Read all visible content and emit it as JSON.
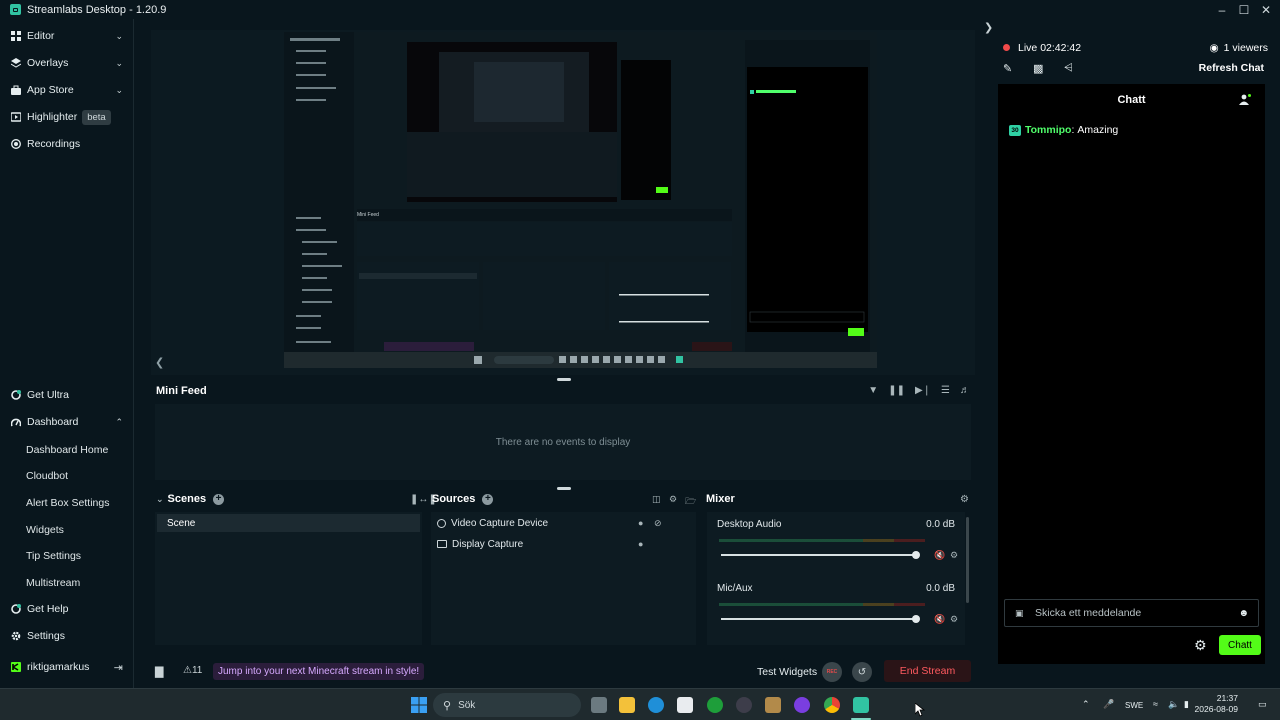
{
  "app": {
    "title": "Streamlabs Desktop - 1.20.9"
  },
  "nav": {
    "items": [
      {
        "label": "Editor"
      },
      {
        "label": "Overlays"
      },
      {
        "label": "App Store"
      },
      {
        "label": "Highlighter",
        "badge": "beta"
      },
      {
        "label": "Recordings"
      }
    ],
    "bottom": {
      "get_ultra": "Get Ultra",
      "dashboard": "Dashboard",
      "dashboard_items": [
        "Dashboard Home",
        "Cloudbot",
        "Alert Box Settings",
        "Widgets",
        "Tip Settings",
        "Multistream"
      ],
      "get_help": "Get Help",
      "settings": "Settings",
      "username": "riktigamarkus"
    }
  },
  "mini_feed": {
    "title": "Mini Feed",
    "empty_text": "There are no events to display"
  },
  "scenes": {
    "title": "Scenes",
    "items": [
      "Scene"
    ]
  },
  "sources": {
    "title": "Sources",
    "items": [
      "Video Capture Device",
      "Display Capture"
    ]
  },
  "mixer": {
    "title": "Mixer",
    "channels": [
      {
        "name": "Desktop Audio",
        "db": "0.0 dB",
        "level": 1.0
      },
      {
        "name": "Mic/Aux",
        "db": "0.0 dB",
        "level": 1.0
      }
    ]
  },
  "footer": {
    "alert_count": "11",
    "promo": "Jump into your next Minecraft stream in style!",
    "test_widgets": "Test Widgets",
    "rec_label": "REC",
    "end_stream": "End Stream"
  },
  "live": {
    "status": "Live",
    "time": "02:42:42",
    "viewers": "1 viewers",
    "refresh_chat": "Refresh Chat"
  },
  "chat": {
    "title": "Chatt",
    "messages": [
      {
        "badge": "30",
        "user": "Tommipo",
        "text": "Amazing"
      }
    ],
    "placeholder": "Skicka ett meddelande",
    "send_label": "Chatt"
  },
  "taskbar": {
    "search_placeholder": "Sök",
    "lang": "SWE",
    "time": "21:37",
    "date": "2026-08-09"
  },
  "colors": {
    "accent": "#31c3a2",
    "kick_green": "#53fc18",
    "end_stream": "#ff5a5f"
  }
}
